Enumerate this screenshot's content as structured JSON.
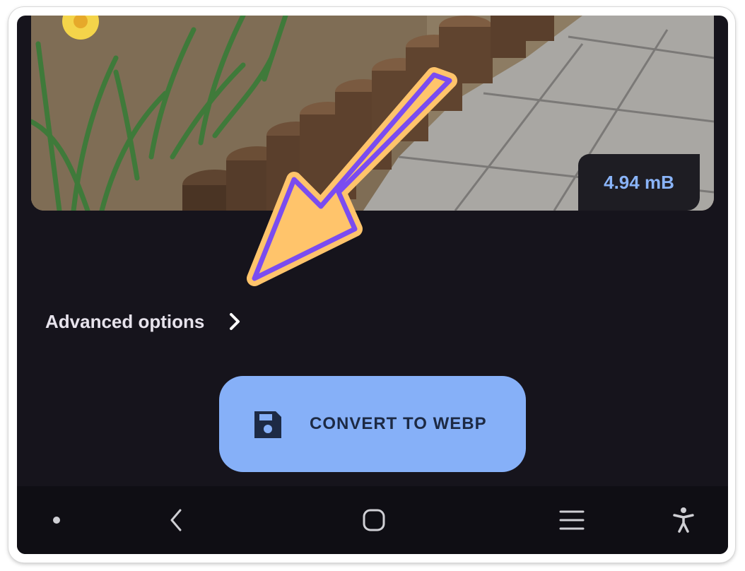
{
  "image_preview": {
    "file_size": "4.94 mB"
  },
  "advanced": {
    "label": "Advanced options",
    "icon": "chevron-right-icon"
  },
  "convert": {
    "label": "CONVERT TO WEBP",
    "icon": "save-icon"
  },
  "navbar": {
    "items": [
      "dot-icon",
      "back-icon",
      "home-icon",
      "recents-icon",
      "accessibility-icon"
    ]
  },
  "colors": {
    "background": "#16141c",
    "accent": "#86b0f8",
    "badge_text": "#8ab4f8",
    "annotation_fill": "#ffc46b",
    "annotation_stroke": "#7a4cf0"
  }
}
